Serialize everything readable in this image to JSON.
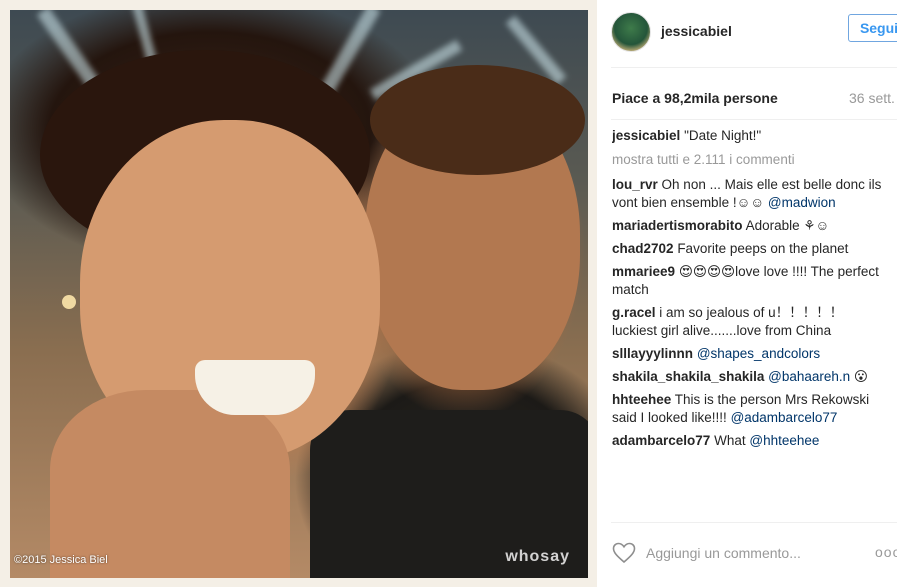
{
  "photo": {
    "copyright": "©2015 Jessica Biel",
    "watermark": "whosay"
  },
  "header": {
    "username": "jessicabiel",
    "follow_label": "Segui"
  },
  "post": {
    "likes": "Piace a 98,2mila persone",
    "time": "36 sett.",
    "caption_user": "jessicabiel",
    "caption_text": "\"Date Night!\"",
    "show_all": "mostra tutti e 2.111 i commenti"
  },
  "comments": [
    {
      "user": "lou_rvr",
      "text": "Oh non ... Mais elle est belle donc ils vont bien ensemble !☺☺",
      "mention": "@madwion"
    },
    {
      "user": "mariadertismorabito",
      "text": "Adorable ⚘☺",
      "mention": ""
    },
    {
      "user": "chad2702",
      "text": "Favorite peeps on the planet",
      "mention": ""
    },
    {
      "user": "mmariee9",
      "text": "😍😍😍😍love love !!!! The perfect match",
      "mention": ""
    },
    {
      "user": "g.racel",
      "text": "i am so jealous of u！！！！！ luckiest girl alive.......love from China",
      "mention": ""
    },
    {
      "user": "slllayyylinnn",
      "text": "",
      "mention": "@shapes_andcolors"
    },
    {
      "user": "shakila_shakila_shakila",
      "text": "😮",
      "mention": "@bahaareh.n"
    },
    {
      "user": "hhteehee",
      "text": "This is the person Mrs Rekowski said I looked like!!!!",
      "mention": "@adambarcelo77"
    },
    {
      "user": "adambarcelo77",
      "text": "What",
      "mention": "@hhteehee"
    }
  ],
  "footer": {
    "add_comment_placeholder": "Aggiungi un commento...",
    "more": "ooo"
  },
  "colors": {
    "accent": "#3897f0",
    "muted": "#999999",
    "mention": "#003569"
  }
}
